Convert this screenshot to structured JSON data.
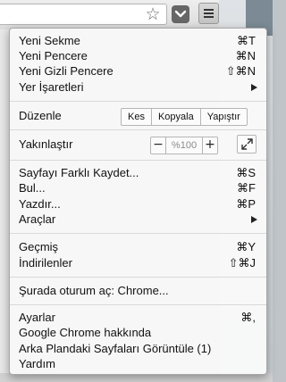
{
  "menu": {
    "items": [
      {
        "label": "Yeni Sekme",
        "shortcut": "⌘T"
      },
      {
        "label": "Yeni Pencere",
        "shortcut": "⌘N"
      },
      {
        "label": "Yeni Gizli Pencere",
        "shortcut": "⇧⌘N"
      },
      {
        "label": "Yer İşaretleri",
        "submenu": true
      },
      {
        "label": "Düzenle"
      },
      {
        "label": "Yakınlaştır"
      },
      {
        "label": "Sayfayı Farklı Kaydet...",
        "shortcut": "⌘S"
      },
      {
        "label": "Bul...",
        "shortcut": "⌘F"
      },
      {
        "label": "Yazdır...",
        "shortcut": "⌘P"
      },
      {
        "label": "Araçlar",
        "submenu": true
      },
      {
        "label": "Geçmiş",
        "shortcut": "⌘Y"
      },
      {
        "label": "İndirilenler",
        "shortcut": "⇧⌘J"
      },
      {
        "label": "Şurada oturum aç: Chrome..."
      },
      {
        "label": "Ayarlar",
        "shortcut": "⌘,"
      },
      {
        "label": "Google Chrome hakkında"
      },
      {
        "label": "Arka Plandaki Sayfaları Görüntüle (1)"
      },
      {
        "label": "Yardım"
      }
    ],
    "edit": {
      "cut": "Kes",
      "copy": "Kopyala",
      "paste": "Yapıştır"
    },
    "zoom": {
      "minus": "−",
      "value": "%100",
      "plus": "+"
    }
  },
  "toolbar": {
    "star_icon": "☆"
  }
}
